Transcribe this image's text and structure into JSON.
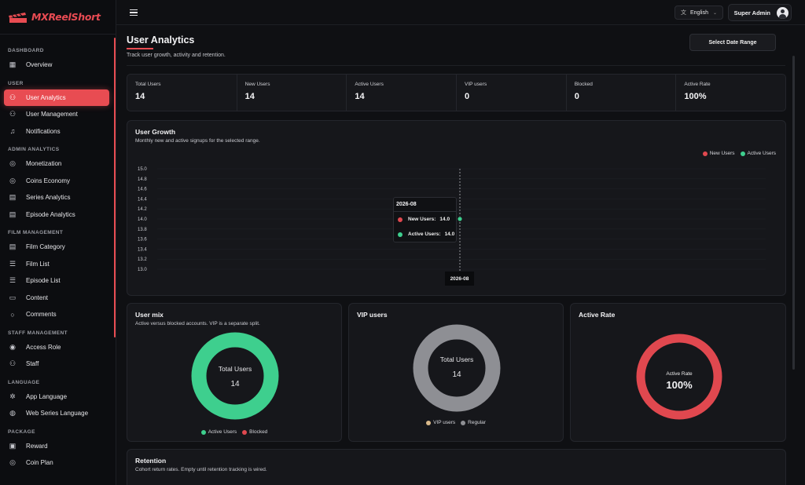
{
  "brand": {
    "name": "MXReelShort",
    "accent": "#e84c52"
  },
  "sidebar": {
    "sections": [
      {
        "title": "DASHBOARD",
        "items": [
          {
            "label": "Overview",
            "icon": "grid-icon"
          }
        ]
      },
      {
        "title": "USER",
        "items": [
          {
            "label": "User Analytics",
            "icon": "users-icon",
            "active": true
          },
          {
            "label": "User Management",
            "icon": "users-icon"
          },
          {
            "label": "Notifications",
            "icon": "bell-icon"
          }
        ]
      },
      {
        "title": "ADMIN ANALYTICS",
        "items": [
          {
            "label": "Monetization",
            "icon": "coins-icon"
          },
          {
            "label": "Coins Economy",
            "icon": "coins-icon"
          },
          {
            "label": "Series Analytics",
            "icon": "film-icon"
          },
          {
            "label": "Episode Analytics",
            "icon": "film-icon"
          }
        ]
      },
      {
        "title": "FILM MANAGEMENT",
        "items": [
          {
            "label": "Film Category",
            "icon": "film-icon"
          },
          {
            "label": "Film List",
            "icon": "list-icon"
          },
          {
            "label": "Episode List",
            "icon": "list-icon"
          },
          {
            "label": "Content",
            "icon": "document-icon"
          },
          {
            "label": "Comments",
            "icon": "comment-icon"
          }
        ]
      },
      {
        "title": "STAFF MANAGEMENT",
        "items": [
          {
            "label": "Access Role",
            "icon": "shield-icon"
          },
          {
            "label": "Staff",
            "icon": "users-icon"
          }
        ]
      },
      {
        "title": "LANGUAGE",
        "items": [
          {
            "label": "App Language",
            "icon": "gear-icon"
          },
          {
            "label": "Web Series Language",
            "icon": "globe-icon"
          }
        ]
      },
      {
        "title": "PACKAGE",
        "items": [
          {
            "label": "Reward",
            "icon": "gift-icon"
          },
          {
            "label": "Coin Plan",
            "icon": "coins-icon"
          }
        ]
      }
    ]
  },
  "topbar": {
    "language": "English",
    "user": "Super Admin"
  },
  "page": {
    "title": "User Analytics",
    "subtitle": "Track user growth, activity and retention.",
    "date_button": "Select Date Range"
  },
  "stats": [
    {
      "label": "Total Users",
      "value": "14"
    },
    {
      "label": "New Users",
      "value": "14"
    },
    {
      "label": "Active Users",
      "value": "14"
    },
    {
      "label": "VIP users",
      "value": "0"
    },
    {
      "label": "Blocked",
      "value": "0"
    },
    {
      "label": "Active Rate",
      "value": "100%"
    }
  ],
  "growth": {
    "title": "User Growth",
    "subtitle": "Monthly new and active signups for the selected range.",
    "legend": [
      "New Users",
      "Active Users"
    ],
    "tooltip": {
      "header": "2026-08",
      "rows": [
        {
          "label": "New Users:",
          "value": "14.0"
        },
        {
          "label": "Active Users:",
          "value": "14.0"
        }
      ]
    },
    "axis_tip": "2026-08"
  },
  "chart_data": {
    "type": "line",
    "x": [
      "2026-08"
    ],
    "series": [
      {
        "name": "New Users",
        "values": [
          14
        ],
        "color": "#e0484f"
      },
      {
        "name": "Active Users",
        "values": [
          14
        ],
        "color": "#3ecf8e"
      }
    ],
    "yticks": [
      "15.0",
      "14.8",
      "14.6",
      "14.4",
      "14.2",
      "14.0",
      "13.8",
      "13.6",
      "13.4",
      "13.2",
      "13.0"
    ],
    "ylim": [
      13,
      15
    ],
    "legend": "top-right"
  },
  "mix": {
    "title": "User mix",
    "subtitle": "Active versus blocked accounts. VIP is a separate split.",
    "center_label": "Total Users",
    "center_value": "14",
    "legend": [
      {
        "label": "Active Users",
        "color": "#3ecf8e"
      },
      {
        "label": "Blocked",
        "color": "#e0484f"
      }
    ],
    "values": [
      14,
      0
    ]
  },
  "vip": {
    "title": "VIP users",
    "center_label": "Total Users",
    "center_value": "14",
    "legend": [
      {
        "label": "VIP users",
        "color": "#d9b98a"
      },
      {
        "label": "Regular",
        "color": "#8e8f94"
      }
    ],
    "values": [
      0,
      14
    ]
  },
  "rate": {
    "title": "Active Rate",
    "center_label": "Active Rate",
    "center_value": "100%",
    "fraction": 1.0,
    "color": "#e0484f"
  },
  "retention": {
    "title": "Retention",
    "subtitle": "Cohort return rates. Empty until retention tracking is wired."
  }
}
